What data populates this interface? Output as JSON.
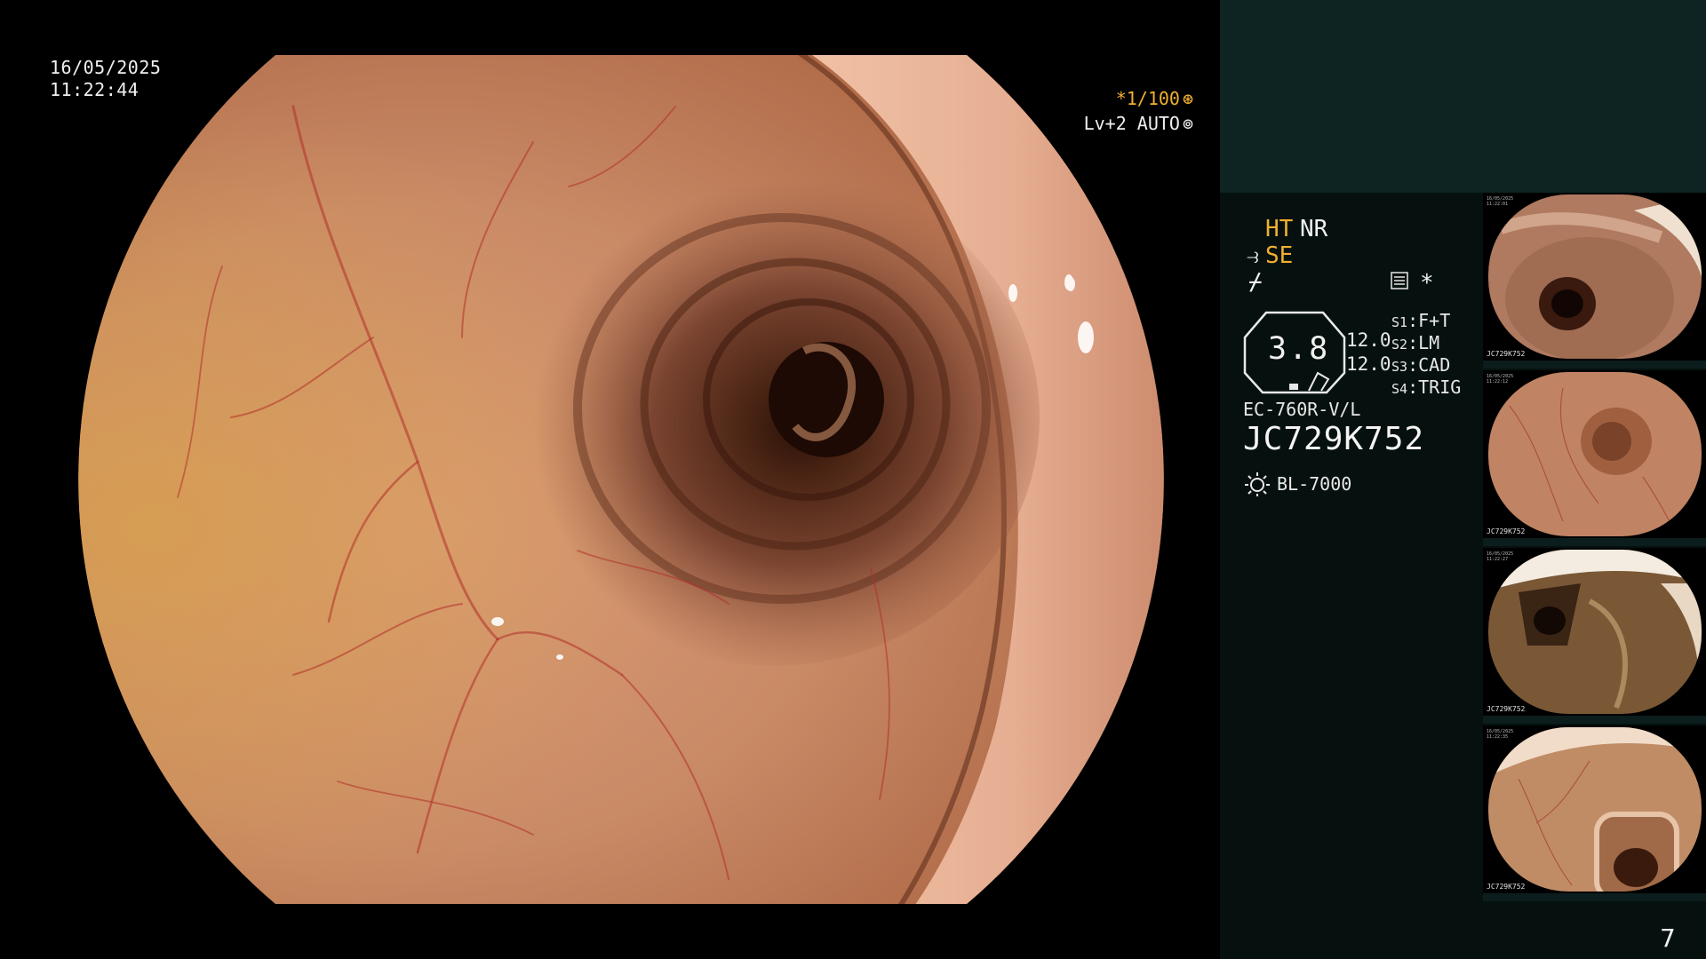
{
  "overlay": {
    "date": "16/05/2025",
    "time": "11:22:44",
    "shutter": "*1/100",
    "shutter_icon": "aperture-icon",
    "exposure": "Lv+2 AUTO",
    "exposure_icon": "iris-icon"
  },
  "panel": {
    "ht": "HT",
    "nr": "NR",
    "se": "SE",
    "se_icon": "structure-enhance-icon",
    "nf_icon": "flow-off-icon",
    "menu_icon": "menu-icon",
    "asterisk": "*",
    "gauge_value": "3.8",
    "values": [
      "12.0",
      "12.0"
    ],
    "switches": [
      {
        "key": "S1",
        "value": "F+T"
      },
      {
        "key": "S2",
        "value": "LM"
      },
      {
        "key": "S3",
        "value": "CAD"
      },
      {
        "key": "S4",
        "value": "TRIG"
      }
    ],
    "scope_model": "EC-760R-V/L",
    "scope_serial": "JC729K752",
    "light_source": "BL-7000",
    "light_icon": "sun-icon",
    "page_number": "7"
  },
  "thumbnails": [
    {
      "date": "16/05/2025",
      "time": "11:22:01",
      "serial": "JC729K752"
    },
    {
      "date": "16/05/2025",
      "time": "11:22:12",
      "serial": "JC729K752"
    },
    {
      "date": "16/05/2025",
      "time": "11:22:27",
      "serial": "JC729K752"
    },
    {
      "date": "16/05/2025",
      "time": "11:22:35",
      "serial": "JC729K752"
    }
  ],
  "colors": {
    "accent": "#f0b030",
    "panel_bg": "#06110f",
    "panel_top": "#0d2422"
  }
}
